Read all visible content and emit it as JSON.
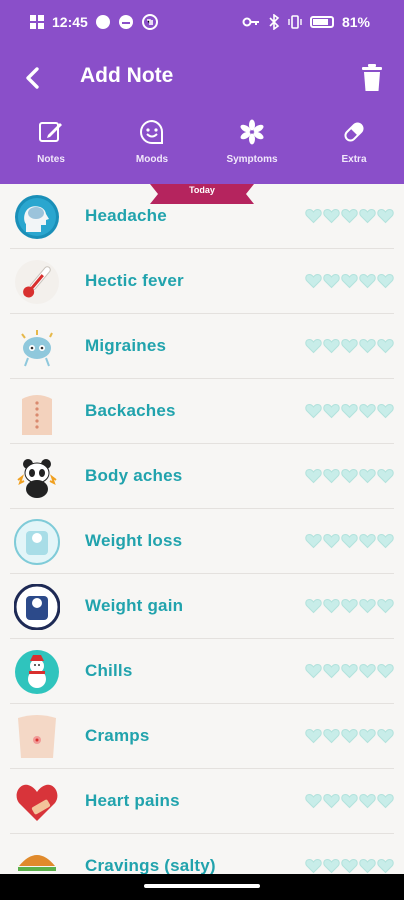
{
  "status_bar": {
    "time": "12:45",
    "battery": "81%"
  },
  "header": {
    "title": "Add Note"
  },
  "tabs": [
    {
      "label": "Notes",
      "icon": "edit-note-icon"
    },
    {
      "label": "Moods",
      "icon": "smiley-icon"
    },
    {
      "label": "Symptoms",
      "icon": "asterisk-icon"
    },
    {
      "label": "Extra",
      "icon": "pill-icon"
    }
  ],
  "today_label": "Today",
  "symptoms": [
    {
      "label": "Headache",
      "icon": "brain-head-icon",
      "rating": 0
    },
    {
      "label": "Hectic fever",
      "icon": "thermometer-icon",
      "rating": 0
    },
    {
      "label": "Migraines",
      "icon": "brain-character-icon",
      "rating": 0
    },
    {
      "label": "Backaches",
      "icon": "back-spine-icon",
      "rating": 0
    },
    {
      "label": "Body aches",
      "icon": "panda-icon",
      "rating": 0
    },
    {
      "label": "Weight loss",
      "icon": "scale-light-icon",
      "rating": 0
    },
    {
      "label": "Weight gain",
      "icon": "scale-dark-icon",
      "rating": 0
    },
    {
      "label": "Chills",
      "icon": "snowman-icon",
      "rating": 0
    },
    {
      "label": "Cramps",
      "icon": "abdomen-icon",
      "rating": 0
    },
    {
      "label": "Heart pains",
      "icon": "heart-bandage-icon",
      "rating": 0
    },
    {
      "label": "Cravings (salty)",
      "icon": "burger-icon",
      "rating": 0
    }
  ],
  "colors": {
    "header": "#8a4fc9",
    "label": "#21a3ad",
    "heart": "#c8ede9",
    "ribbon": "#b5245e"
  }
}
